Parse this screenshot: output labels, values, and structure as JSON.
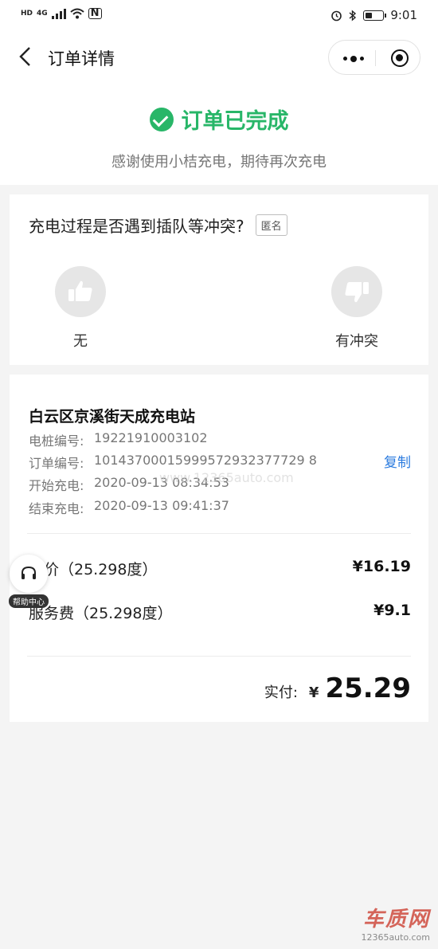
{
  "status_bar": {
    "network_label": "HD",
    "network_gen": "4G",
    "time": "9:01",
    "nfc": "N"
  },
  "nav": {
    "title": "订单详情"
  },
  "order_status": {
    "title": "订单已完成",
    "subtitle": "感谢使用小桔充电，期待再次充电",
    "accent_color": "#28b668"
  },
  "feedback": {
    "question": "充电过程是否遇到插队等冲突?",
    "anonymous_label": "匿名",
    "option_none_label": "无",
    "option_conflict_label": "有冲突"
  },
  "order": {
    "station_name": "白云区京溪街天成充电站",
    "details": [
      {
        "key": "电桩编号:",
        "value": "19221910003102"
      },
      {
        "key": "订单编号:",
        "value": "10143700015999572932377729 8"
      },
      {
        "key": "开始充电:",
        "value": "2020-09-13 08:34:53"
      },
      {
        "key": "结束充电:",
        "value": "2020-09-13 09:41:37"
      }
    ],
    "copy_label": "复制",
    "fees": [
      {
        "label": "电价（25.298度）",
        "amount": "¥16.19"
      },
      {
        "label": "服务费（25.298度）",
        "amount": "¥9.1"
      }
    ],
    "paid_label": "实付:",
    "paid_currency": "¥",
    "paid_amount": "25.29"
  },
  "help": {
    "label": "帮助中心"
  },
  "watermark": {
    "logo_text": "车质网",
    "url": "12365auto.com",
    "center_text": "www.12365auto.com"
  }
}
